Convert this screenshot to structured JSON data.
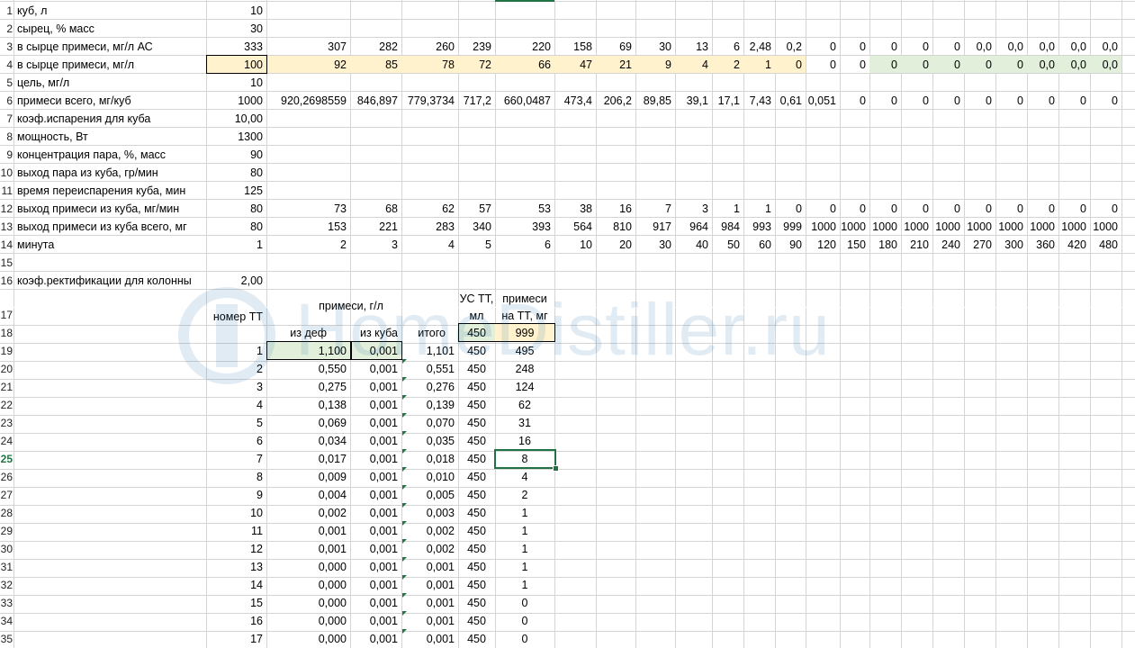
{
  "rows": {
    "r1": {
      "num": "1",
      "label": "куб, л",
      "value": "10"
    },
    "r2": {
      "num": "2",
      "label": "сырец, % масс",
      "value": "30"
    },
    "r3": {
      "num": "3",
      "label": "в сырце примеси, мг/л АС",
      "value": "333",
      "series": [
        "307",
        "282",
        "260",
        "239",
        "220",
        "158",
        "69",
        "30",
        "13",
        "6",
        "2,48",
        "0,2",
        "0",
        "0",
        "0",
        "0",
        "0",
        "0,0",
        "0,0",
        "0,0",
        "0,0",
        "0,0"
      ]
    },
    "r4": {
      "num": "4",
      "label": "в сырце примеси, мг/л",
      "value": "100",
      "series": [
        "92",
        "85",
        "78",
        "72",
        "66",
        "47",
        "21",
        "9",
        "4",
        "2",
        "1",
        "0",
        "0",
        "0",
        "0",
        "0",
        "0",
        "0",
        "0",
        "0,0",
        "0,0",
        "0,0"
      ]
    },
    "r5": {
      "num": "5",
      "label": "цель, мг/л",
      "value": "10"
    },
    "r6": {
      "num": "6",
      "label": "примеси всего, мг/куб",
      "value": "1000",
      "series": [
        "920,2698559",
        "846,897",
        "779,3734",
        "717,2",
        "660,0487",
        "473,4",
        "206,2",
        "89,85",
        "39,1",
        "17,1",
        "7,43",
        "0,61",
        "0,051",
        "0",
        "0",
        "0",
        "0",
        "0",
        "0",
        "0",
        "0",
        "0"
      ]
    },
    "r7": {
      "num": "7",
      "label": "коэф.испарения для куба",
      "value": "10,00"
    },
    "r8": {
      "num": "8",
      "label": "мощность, Вт",
      "value": "1300"
    },
    "r9": {
      "num": "9",
      "label": "концентрация пара, %, масс",
      "value": "90"
    },
    "r10": {
      "num": "10",
      "label": "выход пара из куба, гр/мин",
      "value": "80"
    },
    "r11": {
      "num": "11",
      "label": "время переиспарения куба, мин",
      "value": "125"
    },
    "r12": {
      "num": "12",
      "label": "выход примеси из куба, мг/мин",
      "value": "80",
      "series": [
        "73",
        "68",
        "62",
        "57",
        "53",
        "38",
        "16",
        "7",
        "3",
        "1",
        "1",
        "0",
        "0",
        "0",
        "0",
        "0",
        "0",
        "0",
        "0",
        "0",
        "0",
        "0"
      ]
    },
    "r13": {
      "num": "13",
      "label": "выход примеси из куба всего, мг",
      "value": "80",
      "series": [
        "153",
        "221",
        "283",
        "340",
        "393",
        "564",
        "810",
        "917",
        "964",
        "984",
        "993",
        "999",
        "1000",
        "1000",
        "1000",
        "1000",
        "1000",
        "1000",
        "1000",
        "1000",
        "1000",
        "1000"
      ]
    },
    "r14": {
      "num": "14",
      "label": "минута",
      "value": "1",
      "series": [
        "2",
        "3",
        "4",
        "5",
        "6",
        "10",
        "20",
        "30",
        "40",
        "50",
        "60",
        "90",
        "120",
        "150",
        "180",
        "210",
        "240",
        "270",
        "300",
        "360",
        "420",
        "480"
      ]
    },
    "r15": {
      "num": "15"
    },
    "r16": {
      "num": "16",
      "label": "коэф.ректификации для колонны",
      "value": "2,00"
    },
    "r17": {
      "num": "17",
      "hdr_nomer": "номер ТТ",
      "hdr_primesi": "примеси, г/л",
      "hdr_us1": "УС ТТ,",
      "hdr_us2": "мл",
      "hdr_pn1": "примеси",
      "hdr_pn2": "на ТТ, мг"
    },
    "r18": {
      "num": "18",
      "iz_def": "из деф",
      "iz_kuba": "из куба",
      "itogo": "итого",
      "us_val": "450",
      "total": "999"
    }
  },
  "table": [
    {
      "num": "19",
      "n": "1",
      "def": "1,100",
      "kuba": "0,001",
      "itogo": "1,101",
      "us": "450",
      "mg": "495"
    },
    {
      "num": "20",
      "n": "2",
      "def": "0,550",
      "kuba": "0,001",
      "itogo": "0,551",
      "us": "450",
      "mg": "248"
    },
    {
      "num": "21",
      "n": "3",
      "def": "0,275",
      "kuba": "0,001",
      "itogo": "0,276",
      "us": "450",
      "mg": "124"
    },
    {
      "num": "22",
      "n": "4",
      "def": "0,138",
      "kuba": "0,001",
      "itogo": "0,139",
      "us": "450",
      "mg": "62"
    },
    {
      "num": "23",
      "n": "5",
      "def": "0,069",
      "kuba": "0,001",
      "itogo": "0,070",
      "us": "450",
      "mg": "31"
    },
    {
      "num": "24",
      "n": "6",
      "def": "0,034",
      "kuba": "0,001",
      "itogo": "0,035",
      "us": "450",
      "mg": "16"
    },
    {
      "num": "25",
      "n": "7",
      "def": "0,017",
      "kuba": "0,001",
      "itogo": "0,018",
      "us": "450",
      "mg": "8"
    },
    {
      "num": "26",
      "n": "8",
      "def": "0,009",
      "kuba": "0,001",
      "itogo": "0,010",
      "us": "450",
      "mg": "4"
    },
    {
      "num": "27",
      "n": "9",
      "def": "0,004",
      "kuba": "0,001",
      "itogo": "0,005",
      "us": "450",
      "mg": "2"
    },
    {
      "num": "28",
      "n": "10",
      "def": "0,002",
      "kuba": "0,001",
      "itogo": "0,003",
      "us": "450",
      "mg": "1"
    },
    {
      "num": "29",
      "n": "11",
      "def": "0,001",
      "kuba": "0,001",
      "itogo": "0,002",
      "us": "450",
      "mg": "1"
    },
    {
      "num": "30",
      "n": "12",
      "def": "0,001",
      "kuba": "0,001",
      "itogo": "0,002",
      "us": "450",
      "mg": "1"
    },
    {
      "num": "31",
      "n": "13",
      "def": "0,000",
      "kuba": "0,001",
      "itogo": "0,001",
      "us": "450",
      "mg": "1"
    },
    {
      "num": "32",
      "n": "14",
      "def": "0,000",
      "kuba": "0,001",
      "itogo": "0,001",
      "us": "450",
      "mg": "1"
    },
    {
      "num": "33",
      "n": "15",
      "def": "0,000",
      "kuba": "0,001",
      "itogo": "0,001",
      "us": "450",
      "mg": "0"
    },
    {
      "num": "34",
      "n": "16",
      "def": "0,000",
      "kuba": "0,001",
      "itogo": "0,001",
      "us": "450",
      "mg": "0"
    },
    {
      "num": "35",
      "n": "17",
      "def": "0,000",
      "kuba": "0,001",
      "itogo": "0,001",
      "us": "450",
      "mg": "0"
    }
  ],
  "watermark": "HomeDistiller.ru",
  "colors": {
    "grid": "#d4d4d4",
    "yellow": "#fff2cc",
    "green": "#e2efda",
    "accent": "#217346",
    "watermark": "#1f6fb2"
  }
}
